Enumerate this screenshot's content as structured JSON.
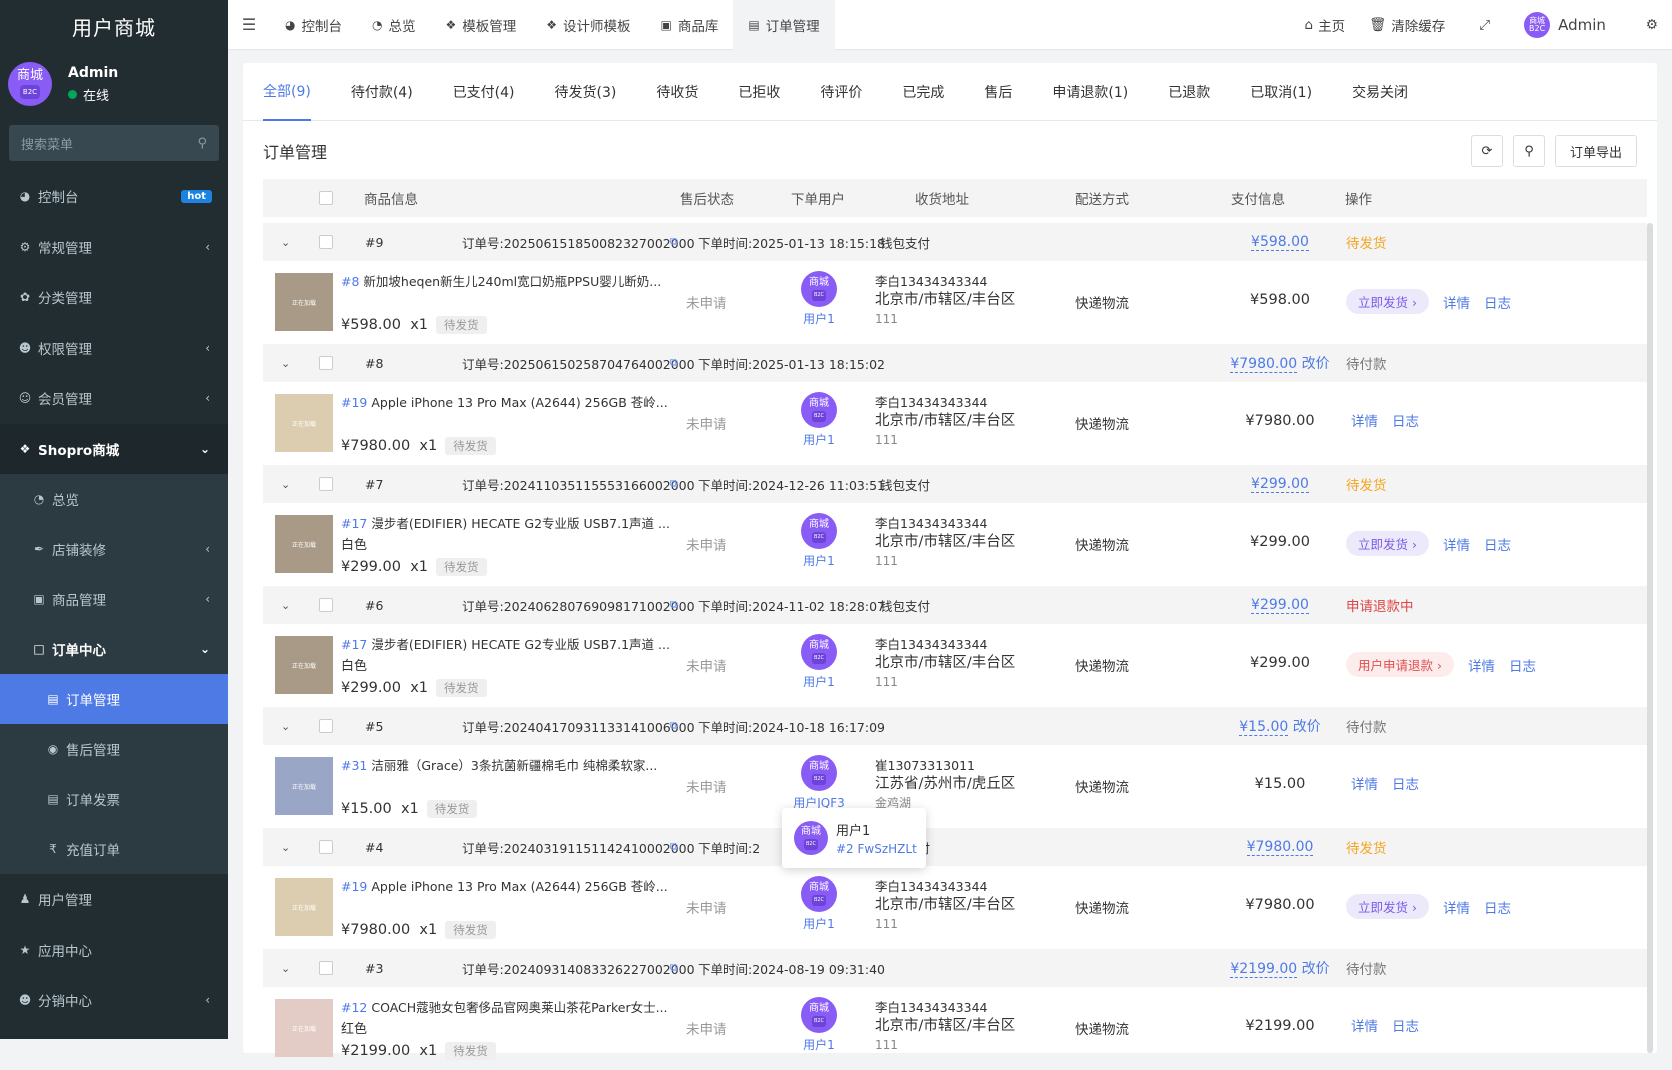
{
  "brand": "用户商城",
  "user": {
    "name": "Admin",
    "status": "在线",
    "avatar_text": "商城",
    "avatar_sub": "B2C"
  },
  "search": {
    "placeholder": "搜索菜单"
  },
  "sidebar": {
    "items": [
      {
        "label": "控制台",
        "icon": "dashboard-icon",
        "badge": "hot"
      },
      {
        "label": "常规管理",
        "icon": "cogs-icon"
      },
      {
        "label": "分类管理",
        "icon": "leaf-icon"
      },
      {
        "label": "权限管理",
        "icon": "group-icon"
      },
      {
        "label": "会员管理",
        "icon": "user-circle-icon"
      },
      {
        "label": "Shopro商城",
        "icon": "dropbox-icon"
      },
      {
        "label": "总览",
        "icon": "pie-chart-icon"
      },
      {
        "label": "店铺装修",
        "icon": "brush-icon"
      },
      {
        "label": "商品管理",
        "icon": "archive-icon"
      },
      {
        "label": "订单中心",
        "icon": "file-icon"
      },
      {
        "label": "订单管理",
        "icon": "file-text-icon"
      },
      {
        "label": "售后管理",
        "icon": "eye-icon"
      },
      {
        "label": "订单发票",
        "icon": "invoice-icon"
      },
      {
        "label": "充值订单",
        "icon": "rupee-icon"
      },
      {
        "label": "用户管理",
        "icon": "user-icon"
      },
      {
        "label": "应用中心",
        "icon": "star-icon"
      },
      {
        "label": "分销中心",
        "icon": "users-icon"
      }
    ]
  },
  "topbar": {
    "tabs": [
      "控制台",
      "总览",
      "模板管理",
      "设计师模板",
      "商品库",
      "订单管理"
    ],
    "home": "主页",
    "clear_cache": "清除缓存",
    "admin": "Admin"
  },
  "order_tabs": [
    "全部(9)",
    "待付款(4)",
    "已支付(4)",
    "待发货(3)",
    "待收货",
    "已拒收",
    "待评价",
    "已完成",
    "售后",
    "申请退款(1)",
    "已退款",
    "已取消(1)",
    "交易关闭"
  ],
  "panel": {
    "title": "订单管理",
    "export": "订单导出"
  },
  "columns": [
    "商品信息",
    "售后状态",
    "下单用户",
    "收货地址",
    "配送方式",
    "支付信息",
    "操作"
  ],
  "orders": [
    {
      "idx": "#9",
      "order_no": "订单号:20250615185008232700200​0",
      "time": "下单时间:2025-01-13 18:15:18",
      "pay_type": "钱包支付",
      "pay_amount": "¥598.00",
      "edit_price": "",
      "status": "待发货",
      "status_cls": "st-orange",
      "goods_id": "#8",
      "goods_name": "新加坡heqen新生儿240ml宽口奶瓶PPSU婴儿断奶...",
      "spec": "",
      "price": "¥598.00",
      "qty": "x1",
      "goods_status": "待发货",
      "thumb_color": "#a89a86",
      "aftersale": "未申请",
      "user": "用户1",
      "addr1": "李白13434343344",
      "addr2": "北京市/市辖区/丰台区",
      "addr3": "111",
      "delivery": "快递物流",
      "total": "¥598.00",
      "actions": [
        "立即发货 ›",
        "详情",
        "日志"
      ],
      "pill": "pill"
    },
    {
      "idx": "#8",
      "order_no": "订单号:20250615025870476400200​0",
      "time": "下单时间:2025-01-13 18:15:02",
      "pay_type": "",
      "pay_amount": "¥7980.00",
      "edit_price": "改价",
      "status": "待付款",
      "status_cls": "st-gray",
      "goods_id": "#19",
      "goods_name": "Apple iPhone 13 Pro Max (A2644) 256GB 苍岭...",
      "spec": "",
      "price": "¥7980.00",
      "qty": "x1",
      "goods_status": "待发货",
      "thumb_color": "#dccdb0",
      "aftersale": "未申请",
      "user": "用户1",
      "addr1": "李白13434343344",
      "addr2": "北京市/市辖区/丰台区",
      "addr3": "111",
      "delivery": "快递物流",
      "total": "¥7980.00",
      "actions": [
        "详情",
        "日志"
      ],
      "pill": ""
    },
    {
      "idx": "#7",
      "order_no": "订单号:20241103511555316600200​0",
      "time": "下单时间:2024-12-26 11:03:51",
      "pay_type": "钱包支付",
      "pay_amount": "¥299.00",
      "edit_price": "",
      "status": "待发货",
      "status_cls": "st-orange",
      "goods_id": "#17",
      "goods_name": "漫步者(EDIFIER) HECATE G2专业版 USB7.1声道 ...",
      "spec": "白色",
      "price": "¥299.00",
      "qty": "x1",
      "goods_status": "待发货",
      "thumb_color": "#a89a86",
      "aftersale": "未申请",
      "user": "用户1",
      "addr1": "李白13434343344",
      "addr2": "北京市/市辖区/丰台区",
      "addr3": "111",
      "delivery": "快递物流",
      "total": "¥299.00",
      "actions": [
        "立即发货 ›",
        "详情",
        "日志"
      ],
      "pill": "pill"
    },
    {
      "idx": "#6",
      "order_no": "订单号:20240628076909817100200​0",
      "time": "下单时间:2024-11-02 18:28:07",
      "pay_type": "钱包支付",
      "pay_amount": "¥299.00",
      "edit_price": "",
      "status": "申请退款中",
      "status_cls": "st-red",
      "goods_id": "#17",
      "goods_name": "漫步者(EDIFIER) HECATE G2专业版 USB7.1声道 ...",
      "spec": "白色",
      "price": "¥299.00",
      "qty": "x1",
      "goods_status": "待发货",
      "thumb_color": "#a89a86",
      "aftersale": "未申请",
      "user": "用户1",
      "addr1": "李白13434343344",
      "addr2": "北京市/市辖区/丰台区",
      "addr3": "111",
      "delivery": "快递物流",
      "total": "¥299.00",
      "actions": [
        "用户申请退款 ›",
        "详情",
        "日志"
      ],
      "pill": "pill red"
    },
    {
      "idx": "#5",
      "order_no": "订单号:20240417093113314100600​0",
      "time": "下单时间:2024-10-18 16:17:09",
      "pay_type": "",
      "pay_amount": "¥15.00",
      "edit_price": "改价",
      "status": "待付款",
      "status_cls": "st-gray",
      "goods_id": "#31",
      "goods_name": "洁丽雅（Grace）3条抗菌新疆棉毛巾 纯棉柔软家...",
      "spec": "",
      "price": "¥15.00",
      "qty": "x1",
      "goods_status": "待发货",
      "thumb_color": "#9aa6c5",
      "aftersale": "未申请",
      "user": "用户JQF3",
      "addr1": "崔13073313011",
      "addr2": "江苏省/苏州市/虎丘区",
      "addr3": "金鸡湖",
      "delivery": "快递物流",
      "total": "¥15.00",
      "actions": [
        "详情",
        "日志"
      ],
      "pill": ""
    },
    {
      "idx": "#4",
      "order_no": "订单号:20240319115114241000200​0",
      "time": "下单时间:2",
      "pay_type": "钱包支付",
      "pay_amount": "¥7980.00",
      "edit_price": "",
      "status": "待发货",
      "status_cls": "st-orange",
      "goods_id": "#19",
      "goods_name": "Apple iPhone 13 Pro Max (A2644) 256GB 苍岭...",
      "spec": "",
      "price": "¥7980.00",
      "qty": "x1",
      "goods_status": "待发货",
      "thumb_color": "#dccdb0",
      "aftersale": "未申请",
      "user": "用户1",
      "addr1": "李白13434343344",
      "addr2": "北京市/市辖区/丰台区",
      "addr3": "111",
      "delivery": "快递物流",
      "total": "¥7980.00",
      "actions": [
        "立即发货 ›",
        "详情",
        "日志"
      ],
      "pill": "pill"
    },
    {
      "idx": "#3",
      "order_no": "订单号:20240931408332622700200​0",
      "time": "下单时间:2024-08-19 09:31:40",
      "pay_type": "",
      "pay_amount": "¥2199.00",
      "edit_price": "改价",
      "status": "待付款",
      "status_cls": "st-gray",
      "goods_id": "#12",
      "goods_name": "COACH蔻驰女包奢侈品官网奥莱山茶花Parker女士...",
      "spec": "红色",
      "price": "¥2199.00",
      "qty": "x1",
      "goods_status": "待发货",
      "thumb_color": "#e3ccc6",
      "aftersale": "未申请",
      "user": "用户1",
      "addr1": "李白13434343344",
      "addr2": "北京市/市辖区/丰台区",
      "addr3": "111",
      "delivery": "快递物流",
      "total": "¥2199.00",
      "actions": [
        "详情",
        "日志"
      ],
      "pill": ""
    }
  ],
  "tooltip": {
    "name": "用户1",
    "id": "#2 FwSzHZLt"
  },
  "colors": {
    "accent": "#4e7ae6",
    "sidebar_bg": "#222d32",
    "purple": "#8a5cf6",
    "orange": "#f5a623",
    "red": "#e04545"
  }
}
